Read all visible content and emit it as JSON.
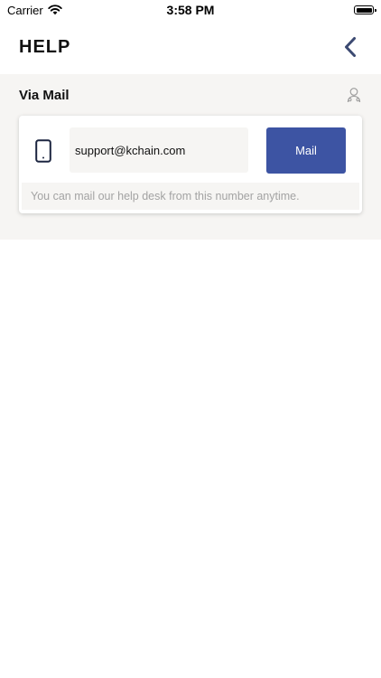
{
  "status_bar": {
    "carrier": "Carrier",
    "time": "3:58 PM"
  },
  "header": {
    "title": "HELP"
  },
  "section": {
    "title": "Via Mail",
    "email": "support@kchain.com",
    "mail_button": "Mail",
    "note": "You can mail our help desk from this number anytime."
  },
  "colors": {
    "accent": "#3d54a3",
    "section_bg": "#f6f5f3",
    "note_text": "#a3a3a3",
    "back_icon": "#3c4a72"
  }
}
